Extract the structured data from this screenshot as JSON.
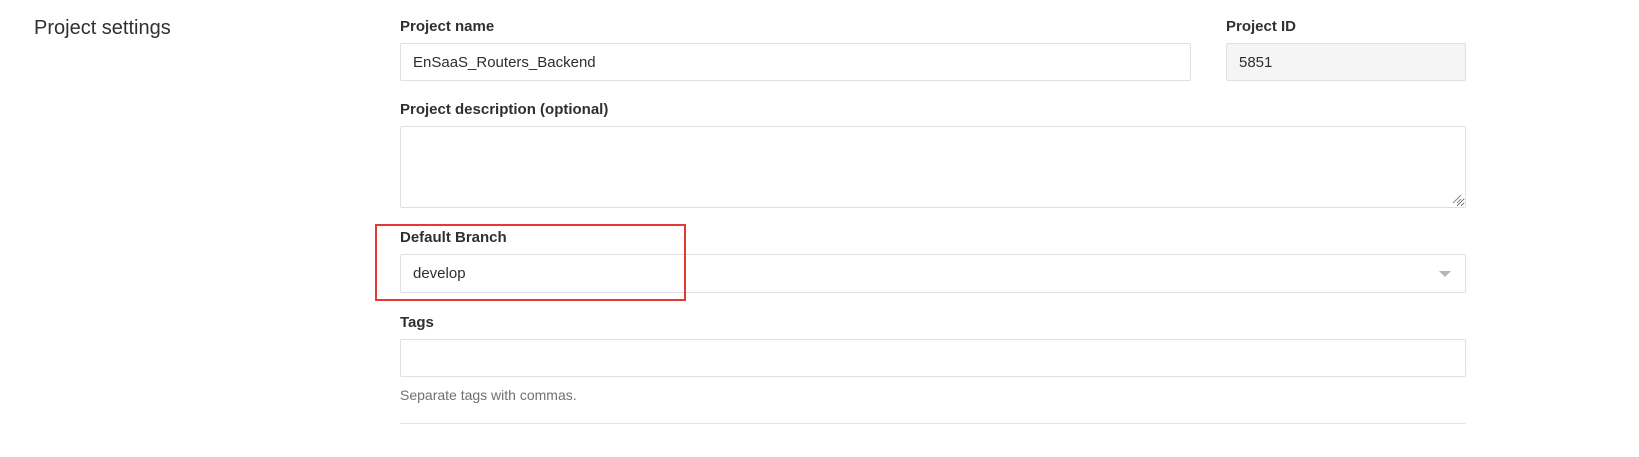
{
  "section": {
    "title": "Project settings"
  },
  "project_name": {
    "label": "Project name",
    "value": "EnSaaS_Routers_Backend"
  },
  "project_id": {
    "label": "Project ID",
    "value": "5851"
  },
  "project_description": {
    "label": "Project description (optional)",
    "value": ""
  },
  "default_branch": {
    "label": "Default Branch",
    "selected": "develop"
  },
  "tags": {
    "label": "Tags",
    "value": "",
    "help": "Separate tags with commas."
  },
  "colors": {
    "highlight": "#e53935",
    "border": "#e0e0e0",
    "readonly_bg": "#f5f5f5"
  }
}
